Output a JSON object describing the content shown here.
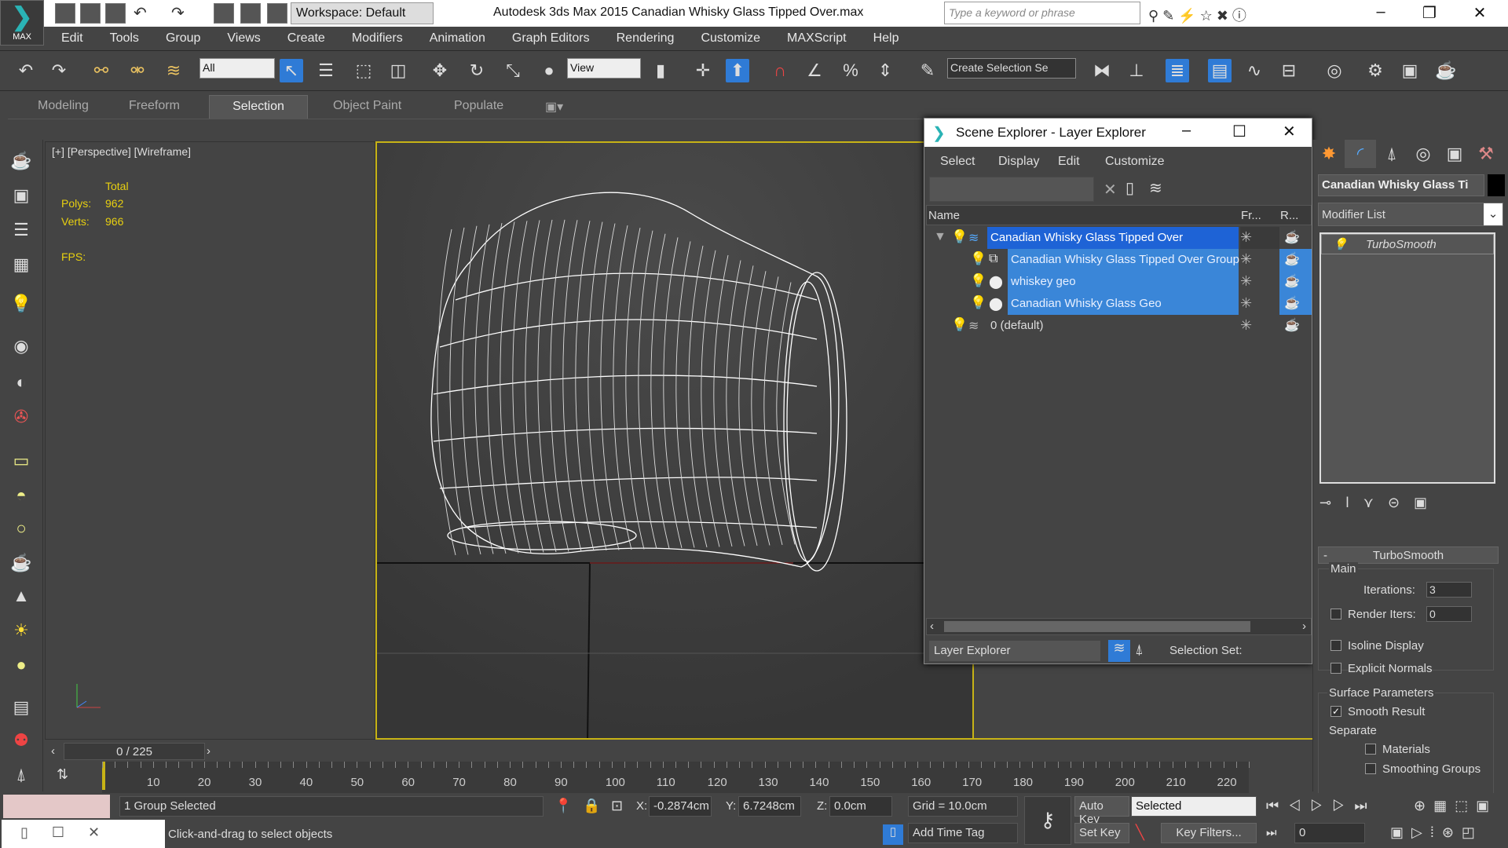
{
  "app": {
    "logo_label": "MAX",
    "workspace": "Workspace: Default",
    "title": "Autodesk 3ds Max 2015    Canadian Whisky Glass Tipped Over.max",
    "search_placeholder": "Type a keyword or phrase"
  },
  "menu": [
    "Edit",
    "Tools",
    "Group",
    "Views",
    "Create",
    "Modifiers",
    "Animation",
    "Graph Editors",
    "Rendering",
    "Customize",
    "MAXScript",
    "Help"
  ],
  "toolbar": {
    "filter": "All",
    "ref_coord": "View",
    "selection_set": "Create Selection Se"
  },
  "ribbon": {
    "tabs": [
      "Modeling",
      "Freeform",
      "Selection",
      "Object Paint",
      "Populate"
    ],
    "active": "Selection"
  },
  "viewport": {
    "label": "[+] [Perspective] [Wireframe]",
    "stats_header": "Total",
    "polys_label": "Polys:",
    "polys": "962",
    "verts_label": "Verts:",
    "verts": "966",
    "fps_label": "FPS:"
  },
  "scene_explorer": {
    "title": "Scene Explorer - Layer Explorer",
    "menu": [
      "Select",
      "Display",
      "Edit",
      "Customize"
    ],
    "columns": [
      "Name",
      "Fr...",
      "R..."
    ],
    "rows": [
      {
        "name": "Canadian Whisky Glass Tipped Over",
        "level": 0,
        "type": "layer",
        "selected": true
      },
      {
        "name": "Canadian Whisky Glass Tipped Over Group",
        "level": 1,
        "type": "group",
        "selected": true
      },
      {
        "name": "whiskey geo",
        "level": 1,
        "type": "object",
        "selected": true
      },
      {
        "name": "Canadian Whisky Glass Geo",
        "level": 1,
        "type": "object",
        "selected": true
      },
      {
        "name": "0 (default)",
        "level": 0,
        "type": "layer",
        "selected": false
      }
    ],
    "explorer_select": "Layer Explorer",
    "selection_set_label": "Selection Set:"
  },
  "command_panel": {
    "object_name": "Canadian Whisky Glass Ti",
    "modifier_list": "Modifier List",
    "stack": [
      "TurboSmooth"
    ],
    "rollout_title": "TurboSmooth",
    "main_label": "Main",
    "iterations_label": "Iterations:",
    "iterations": "3",
    "render_iters_label": "Render Iters:",
    "render_iters": "0",
    "render_iters_checked": false,
    "isoline_label": "Isoline Display",
    "isoline_checked": false,
    "explicit_normals_label": "Explicit Normals",
    "explicit_normals_checked": false,
    "surface_label": "Surface Parameters",
    "smooth_result_label": "Smooth Result",
    "smooth_result_checked": true,
    "separate_label": "Separate",
    "materials_label": "Materials",
    "smoothing_groups_label": "Smoothing Groups"
  },
  "timeline": {
    "frame": "0 / 225",
    "ticks": [
      "10",
      "20",
      "30",
      "40",
      "50",
      "60",
      "70",
      "80",
      "90",
      "100",
      "110",
      "120",
      "130",
      "140",
      "150",
      "160",
      "170",
      "180",
      "190",
      "200",
      "210",
      "220"
    ]
  },
  "status": {
    "selection": "1 Group Selected",
    "prompt": "Click-and-drag to select objects",
    "x_label": "X:",
    "x": "-0.2874cm",
    "y_label": "Y:",
    "y": "6.7248cm",
    "z_label": "Z:",
    "z": "0.0cm",
    "grid": "Grid = 10.0cm",
    "auto_key": "Auto Key",
    "set_key": "Set Key",
    "key_mode": "Selected",
    "key_filters": "Key Filters...",
    "add_time_tag": "Add Time Tag",
    "current_frame": "0"
  }
}
